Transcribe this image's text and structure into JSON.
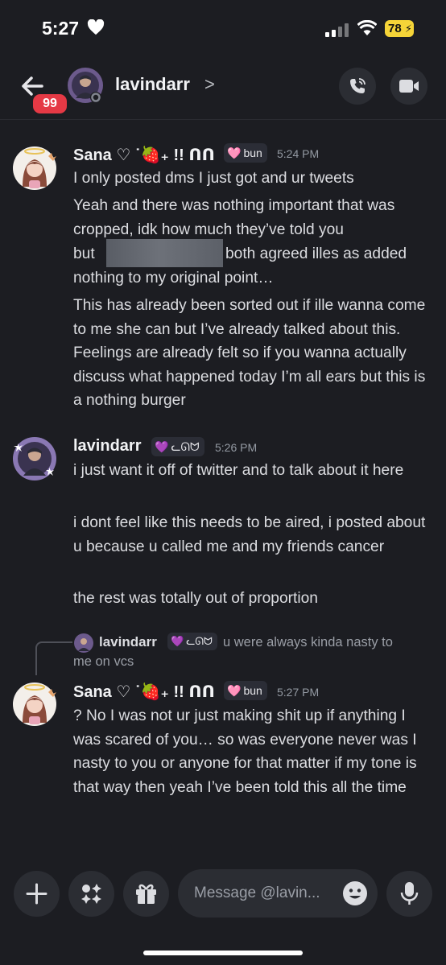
{
  "status": {
    "time": "5:27",
    "battery": "78"
  },
  "header": {
    "badge_count": "99",
    "title": "lavindarr",
    "chevron": ">"
  },
  "messages": [
    {
      "author": "Sana ♡ ˙🍓₊ !! ᑎᑎ",
      "tag_text": "bun",
      "tag_icon": "🩷",
      "time": "5:24 PM",
      "paragraphs": [
        "I only posted dms I just got and ur tweets",
        "Yeah and there was nothing important that was cropped, idk how much they’ve told you",
        "but",
        "both agreed illes as added nothing to my original point…",
        "This has already been sorted out if ille wanna come to me she can but I’ve already talked about this. Feelings are already felt so if you wanna actually discuss what happened today I’m all ears but this is a nothing burger"
      ]
    },
    {
      "author": "lavindarr",
      "tag_text": "ᓚᘏᗢ",
      "tag_icon": "💜",
      "time": "5:26 PM",
      "paragraphs": [
        "i just want it off of twitter and to talk about it here",
        "i dont feel like this needs to be aired, i posted about u because u called me and my friends cancer",
        "the rest was totally out of proportion"
      ]
    },
    {
      "reply": {
        "author": "lavindarr",
        "tag_text": "ᓚᘏᗢ",
        "tag_icon": "💜",
        "text_line1": "u were always kinda nasty to",
        "text_line2": "me on vcs"
      },
      "author": "Sana ♡ ˙🍓₊ !! ᑎᑎ",
      "tag_text": "bun",
      "tag_icon": "🩷",
      "time": "5:27 PM",
      "paragraphs": [
        "? No I was not ur just making shit up if anything I was scared of you… so was everyone never was I nasty to you or anyone for that matter if my tone is that way then yeah I’ve been told this all the time"
      ]
    }
  ],
  "composer": {
    "placeholder": "Message @lavin..."
  },
  "icons": {
    "back": "back-arrow-icon",
    "call": "phone-call-icon",
    "video": "video-camera-icon",
    "plus": "plus-icon",
    "apps": "sparkle-apps-icon",
    "gift": "gift-icon",
    "emoji": "emoji-smile-icon",
    "mic": "microphone-icon"
  },
  "colors": {
    "background": "#1c1d22",
    "badge": "#e53945",
    "battery": "#f5d438"
  }
}
